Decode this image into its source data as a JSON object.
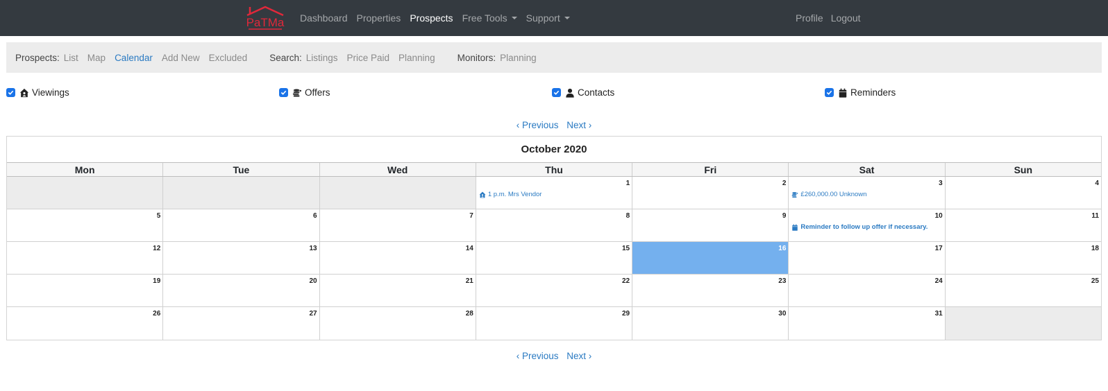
{
  "brand": {
    "logo_text": "PaTMa",
    "logo_color": "#e0283a"
  },
  "nav": {
    "links": [
      {
        "label": "Dashboard",
        "active": false,
        "dropdown": false
      },
      {
        "label": "Properties",
        "active": false,
        "dropdown": false
      },
      {
        "label": "Prospects",
        "active": true,
        "dropdown": false
      },
      {
        "label": "Free Tools",
        "active": false,
        "dropdown": true
      },
      {
        "label": "Support",
        "active": false,
        "dropdown": true
      }
    ],
    "right": [
      {
        "label": "Profile"
      },
      {
        "label": "Logout"
      }
    ]
  },
  "subnav": {
    "prospects": {
      "label": "Prospects:",
      "links": [
        "List",
        "Map",
        "Calendar",
        "Add New",
        "Excluded"
      ],
      "active": "Calendar"
    },
    "search": {
      "label": "Search:",
      "links": [
        "Listings",
        "Price Paid",
        "Planning"
      ]
    },
    "monitors": {
      "label": "Monitors:",
      "links": [
        "Planning"
      ]
    }
  },
  "filters": [
    {
      "label": "Viewings",
      "icon": "house-user-icon",
      "checked": true
    },
    {
      "label": "Offers",
      "icon": "coins-icon",
      "checked": true
    },
    {
      "label": "Contacts",
      "icon": "user-icon",
      "checked": true
    },
    {
      "label": "Reminders",
      "icon": "calendar-icon",
      "checked": true
    }
  ],
  "pager": {
    "previous": "‹ Previous",
    "next": "Next ›"
  },
  "calendar": {
    "title": "October 2020",
    "weekdays": [
      "Mon",
      "Tue",
      "Wed",
      "Thu",
      "Fri",
      "Sat",
      "Sun"
    ],
    "today": 16,
    "weeks": [
      [
        null,
        null,
        null,
        1,
        2,
        3,
        4
      ],
      [
        5,
        6,
        7,
        8,
        9,
        10,
        11
      ],
      [
        12,
        13,
        14,
        15,
        16,
        17,
        18
      ],
      [
        19,
        20,
        21,
        22,
        23,
        24,
        25
      ],
      [
        26,
        27,
        28,
        29,
        30,
        31,
        null
      ]
    ],
    "events": [
      {
        "day": 1,
        "type": "viewing",
        "icon": "house-user-icon",
        "text": "1 p.m. Mrs Vendor",
        "bold": false
      },
      {
        "day": 3,
        "type": "offer",
        "icon": "coins-icon",
        "text": "£260,000.00 Unknown",
        "bold": false
      },
      {
        "day": 10,
        "type": "reminder",
        "icon": "calendar-icon",
        "text": "Reminder to follow up offer if necessary.",
        "bold": true
      }
    ]
  },
  "colors": {
    "accent": "#2a7ac2",
    "today": "#74b0ee",
    "navbar": "#343a40",
    "checkbox": "#1a73e8"
  }
}
